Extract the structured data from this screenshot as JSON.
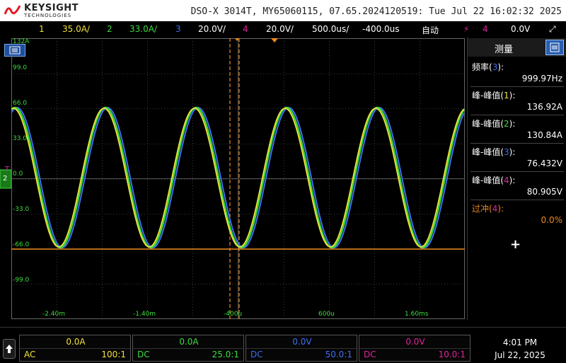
{
  "header": {
    "brand": "KEYSIGHT",
    "brand_sub": "TECHNOLOGIES",
    "instrument_title": "DSO-X 3014T, MY65060115, 07.65.2024120519: Tue Jul 22 16:02:32 2025"
  },
  "channel_bar": {
    "ch1_num": "1",
    "ch1_scale": "35.0A/",
    "ch2_num": "2",
    "ch2_scale": "33.0A/",
    "ch3_num": "3",
    "ch3_scale": "20.0V/",
    "ch4_num": "4",
    "ch4_scale": "20.0V/",
    "timebase": "500.0us/",
    "delay": "-400.0us",
    "trigger_mode": "自动",
    "trigger_source": "4",
    "trigger_level": "0.0V"
  },
  "colors": {
    "ch1": "#f0e23a",
    "ch2": "#3ddc3d",
    "ch3": "#3f6ff0",
    "ch4": "#e0249b",
    "cursor": "#f08a1c",
    "grid": "#3a3a3a"
  },
  "screen": {
    "y_ticks": [
      "132A",
      "99.0",
      "66.0",
      "33.0",
      "0.0",
      "-33.0",
      "-66.0",
      "-99.0"
    ],
    "x_ticks": [
      "-2.40m",
      "-1.40m",
      "-400u",
      "600u",
      "1.60ms"
    ],
    "ground_marker": "2",
    "trigger_marker": "T"
  },
  "panel": {
    "title": "测量",
    "measurements": [
      {
        "name": "频率",
        "ch": "3",
        "value": "999.97Hz",
        "color": "#fff"
      },
      {
        "name": "峰-峰值",
        "ch": "1",
        "value": "136.92A",
        "color": "#fff"
      },
      {
        "name": "峰-峰值",
        "ch": "2",
        "value": "130.84A",
        "color": "#fff"
      },
      {
        "name": "峰-峰值",
        "ch": "3",
        "value": "76.432V",
        "color": "#fff"
      },
      {
        "name": "峰-峰值",
        "ch": "4",
        "value": "80.905V",
        "color": "#fff"
      },
      {
        "name": "过冲",
        "ch": "4",
        "value": "0.0%",
        "color": "#f08a1c"
      }
    ],
    "add_label": "+"
  },
  "bottom": {
    "channels": [
      {
        "offset": "0.0A",
        "coupling": "AC",
        "probe": "100:1"
      },
      {
        "offset": "0.0A",
        "coupling": "DC",
        "probe": "25.0:1"
      },
      {
        "offset": "0.0V",
        "coupling": "DC",
        "probe": "50.0:1"
      },
      {
        "offset": "0.0V",
        "coupling": "DC",
        "probe": "10.0:1"
      }
    ],
    "time": "4:01 PM",
    "date": "Jul 22, 2025"
  }
}
